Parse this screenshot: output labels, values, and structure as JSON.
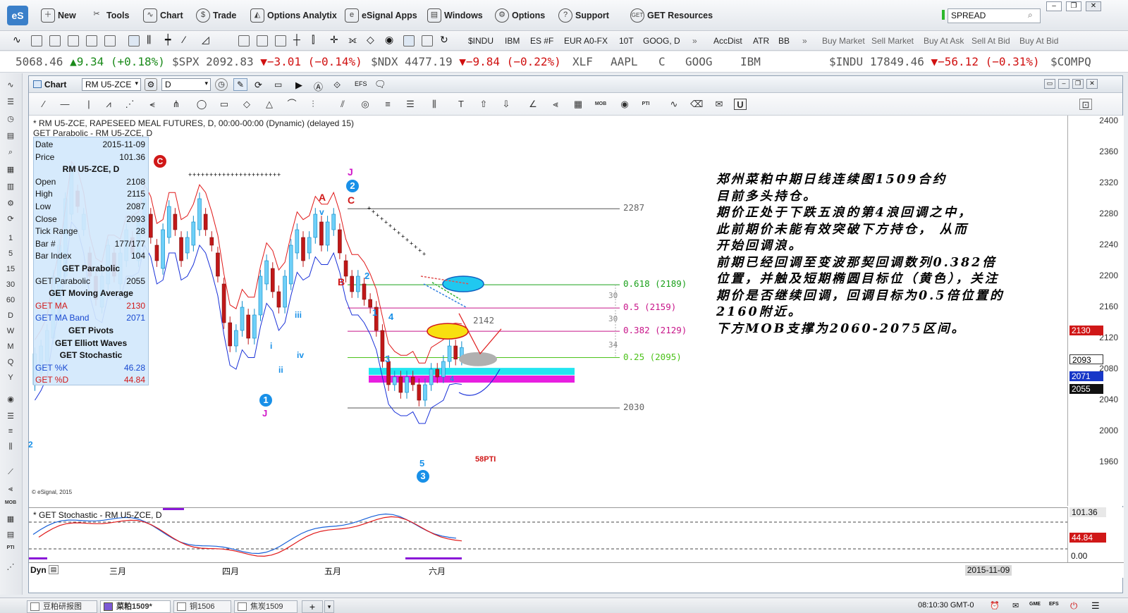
{
  "menu": {
    "logo": "eS",
    "items": [
      "New",
      "Tools",
      "Chart",
      "Trade",
      "Options Analytix",
      "eSignal Apps",
      "Windows",
      "Options",
      "Support",
      "GET Resources"
    ],
    "icons": [
      "new-icon",
      "tools-icon",
      "chart-icon",
      "trade-icon",
      "options-analytix-icon",
      "esignal-apps-icon",
      "windows-icon",
      "options-gear-icon",
      "support-icon",
      "get-resources-icon"
    ],
    "search_value": "SPREAD"
  },
  "toolbar": {
    "symbols": [
      "$INDU",
      "IBM",
      "ES #F",
      "EUR A0-FX",
      "10T",
      "GOOG, D"
    ],
    "studies": [
      "AccDist",
      "ATR",
      "BB"
    ],
    "trade_buttons": [
      "Buy Market",
      "Sell Market",
      "Buy At Ask",
      "Sell At Bid",
      "Buy At Bid"
    ],
    "more": "»"
  },
  "ticker": [
    {
      "sym": "",
      "price": "5068.46",
      "chg": "▲9.34 (+0.18%)",
      "dir": "up"
    },
    {
      "sym": "$SPX",
      "price": "2092.83",
      "chg": "▼−3.01 (−0.14%)",
      "dir": "dn"
    },
    {
      "sym": "$NDX",
      "price": "4477.19",
      "chg": "▼−9.84 (−0.22%)",
      "dir": "dn"
    },
    {
      "sym": "XLF",
      "price": "",
      "chg": "",
      "dir": ""
    },
    {
      "sym": "AAPL",
      "price": "",
      "chg": "",
      "dir": ""
    },
    {
      "sym": "C",
      "price": "",
      "chg": "",
      "dir": ""
    },
    {
      "sym": "GOOG",
      "price": "",
      "chg": "",
      "dir": ""
    },
    {
      "sym": "IBM",
      "price": "",
      "chg": "",
      "dir": ""
    },
    {
      "sym": "$INDU",
      "price": "17849.46",
      "chg": "▼−56.12 (−0.31%)",
      "dir": "dn"
    },
    {
      "sym": "$COMPQ",
      "price": "",
      "chg": "",
      "dir": ""
    }
  ],
  "left_tools": [
    "1",
    "5",
    "15",
    "30",
    "60",
    "D",
    "W",
    "M",
    "Q",
    "Y"
  ],
  "chart_window": {
    "title": "Chart",
    "symbol": "RM U5-ZCE",
    "interval": "D",
    "header_line1": "* RM U5-ZCE, RAPESEED MEAL FUTURES, D, 00:00-00:00 (Dynamic) (delayed 15)",
    "header_line2": "GET Parabolic - RM U5-ZCE, D",
    "watermark": "© eSignal, 2015",
    "stoch_title": "* GET Stochastic - RM U5-ZCE, D",
    "dyn_label": "Dyn"
  },
  "info_panel": [
    {
      "k": "Date",
      "v": "2015-11-09",
      "t": "kv"
    },
    {
      "k": "Price",
      "v": "101.36",
      "t": "kv"
    },
    {
      "k": "RM U5-ZCE, D",
      "v": "",
      "t": "head"
    },
    {
      "k": "Open",
      "v": "2108",
      "t": "kv"
    },
    {
      "k": "High",
      "v": "2115",
      "t": "kv"
    },
    {
      "k": "Low",
      "v": "2087",
      "t": "kv"
    },
    {
      "k": "Close",
      "v": "2093",
      "t": "kv"
    },
    {
      "k": "Tick Range",
      "v": "28",
      "t": "kv"
    },
    {
      "k": "Bar #",
      "v": "177/177",
      "t": "kv"
    },
    {
      "k": "Bar Index",
      "v": "104",
      "t": "kv"
    },
    {
      "k": "GET Parabolic",
      "v": "",
      "t": "head"
    },
    {
      "k": "GET Parabolic",
      "v": "2055",
      "t": "kv"
    },
    {
      "k": "GET Moving Average",
      "v": "",
      "t": "head"
    },
    {
      "k": "GET MA",
      "v": "2130",
      "t": "red"
    },
    {
      "k": "GET MA Band",
      "v": "2071",
      "t": "blue"
    },
    {
      "k": "GET Pivots",
      "v": "",
      "t": "head"
    },
    {
      "k": "GET Elliott Waves",
      "v": "",
      "t": "head"
    },
    {
      "k": "GET Stochastic",
      "v": "",
      "t": "head"
    },
    {
      "k": "GET %K",
      "v": "46.28",
      "t": "blue"
    },
    {
      "k": "GET %D",
      "v": "44.84",
      "t": "red"
    }
  ],
  "annotation": [
    "郑州菜粕中期日线连续图1509合约",
    "目前多头持仓。",
    "期价正处于下跌五浪的第4浪回调之中，",
    "此前期价未能有效突破下方持仓， 从而",
    "开始回调浪。",
    "前期已经回调至变波那契回调数列0.382倍",
    "位置，并触及短期椭圆目标位（黄色），关注",
    "期价是否继续回调，回调目标为0.5倍位置的",
    "2160附近。",
    "下方MOB支撑为2060-2075区间。"
  ],
  "fib": [
    {
      "label": "0.618 (2189)",
      "price": 2189,
      "color": "#1aa01a"
    },
    {
      "label": "0.5 (2159)",
      "price": 2159,
      "color": "#c8168a"
    },
    {
      "label": "0.382 (2129)",
      "price": 2129,
      "color": "#c8168a"
    },
    {
      "label": "0.25 (2095)",
      "price": 2095,
      "color": "#4cc21a"
    }
  ],
  "levels": [
    {
      "label": "2287",
      "price": 2287
    },
    {
      "label": "2030",
      "price": 2030
    },
    {
      "label": "2142",
      "price": 2142
    }
  ],
  "fib_gaps": [
    "30",
    "30",
    "34"
  ],
  "y_ticks": [
    "2400",
    "2360",
    "2320",
    "2280",
    "2240",
    "2200",
    "2160",
    "2120",
    "2080",
    "2040",
    "2000",
    "1960"
  ],
  "y_tags": [
    {
      "label": "2130",
      "price": 2130,
      "color": "#d01818"
    },
    {
      "label": "2093",
      "price": 2093,
      "color": "#333333",
      "fg": "#000"
    },
    {
      "label": "2071",
      "price": 2071,
      "color": "#1838c8"
    },
    {
      "label": "2055",
      "price": 2055,
      "color": "#111111"
    }
  ],
  "stoch_axis": {
    "top": "101.36",
    "mid": "44.84",
    "bottom": "0.00"
  },
  "time_labels": [
    "三月",
    "四月",
    "五月",
    "六月"
  ],
  "time_cursor": "2015-11-09",
  "wave_labels": {
    "j1": "J",
    "n2": "2",
    "c1": "C",
    "a1": "A",
    "v1": "v",
    "b1": "B",
    "n1": "1",
    "j2": "J",
    "i1": "i",
    "ii1": "ii",
    "iii1": "iii",
    "iv1": "iv",
    "w1": "1",
    "w2": "2",
    "w3": "3",
    "w4": "4",
    "w5": "5",
    "n3": "3",
    "d3": "-3-",
    "pti": "58PTI",
    "w4b": "4",
    "two": "2",
    "c_top": "C",
    "j_top": "J"
  },
  "status": {
    "tabs": [
      "豆粕研报图",
      "菜粕1509*",
      "铜1506",
      "焦炭1509"
    ],
    "active_tab": 1,
    "time": "08:10:30 GMT-0"
  }
}
